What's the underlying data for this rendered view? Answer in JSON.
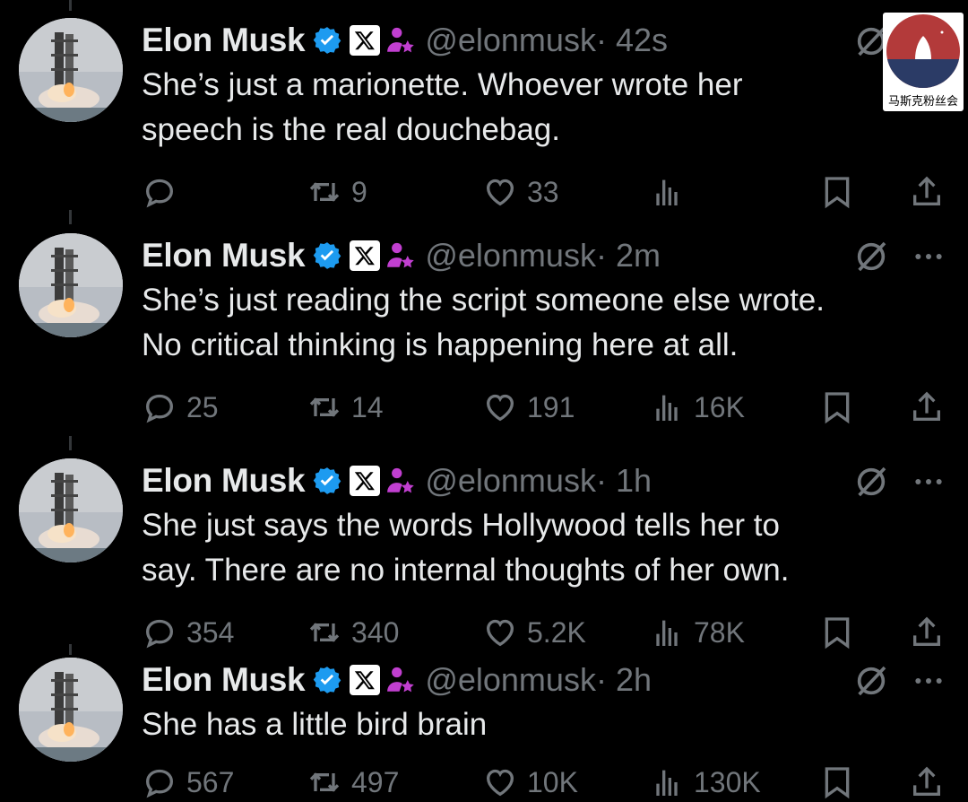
{
  "watermark": {
    "label": "马斯克粉丝会"
  },
  "tweets": [
    {
      "name": "Elon Musk",
      "handle": "@elonmusk",
      "time": "· 42s",
      "text_line1": "She’s just a marionette. Whoever wrote her",
      "text_line2": "speech is the real douchebag.",
      "replies": "",
      "reposts": "9",
      "likes": "33",
      "views": ""
    },
    {
      "name": "Elon Musk",
      "handle": "@elonmusk",
      "time": "· 2m",
      "text_line1": "She’s just reading the script someone else wrote.",
      "text_line2": "No critical thinking is happening here at all.",
      "replies": "25",
      "reposts": "14",
      "likes": "191",
      "views": "16K"
    },
    {
      "name": "Elon Musk",
      "handle": "@elonmusk",
      "time": "· 1h",
      "text_line1": "She just says the words Hollywood tells her to",
      "text_line2": "say. There are no internal thoughts of her own.",
      "replies": "354",
      "reposts": "340",
      "likes": "5.2K",
      "views": "78K"
    },
    {
      "name": "Elon Musk",
      "handle": "@elonmusk",
      "time": "· 2h",
      "text_line1": "She has a little bird brain",
      "text_line2": "",
      "replies": "567",
      "reposts": "497",
      "likes": "10K",
      "views": "130K"
    }
  ],
  "icons": {
    "verified": "verified-badge-icon",
    "x_badge": "x-logo-icon",
    "affiliate": "affiliate-person-icon",
    "grok": "grok-icon",
    "more": "more-dots-icon",
    "reply": "reply-icon",
    "repost": "repost-icon",
    "like": "like-icon",
    "views": "views-icon",
    "bookmark": "bookmark-icon",
    "share": "share-icon"
  },
  "colors": {
    "verified_blue": "#1d9bf0",
    "affiliate_purple": "#c13fd0",
    "muted": "#71767b"
  }
}
